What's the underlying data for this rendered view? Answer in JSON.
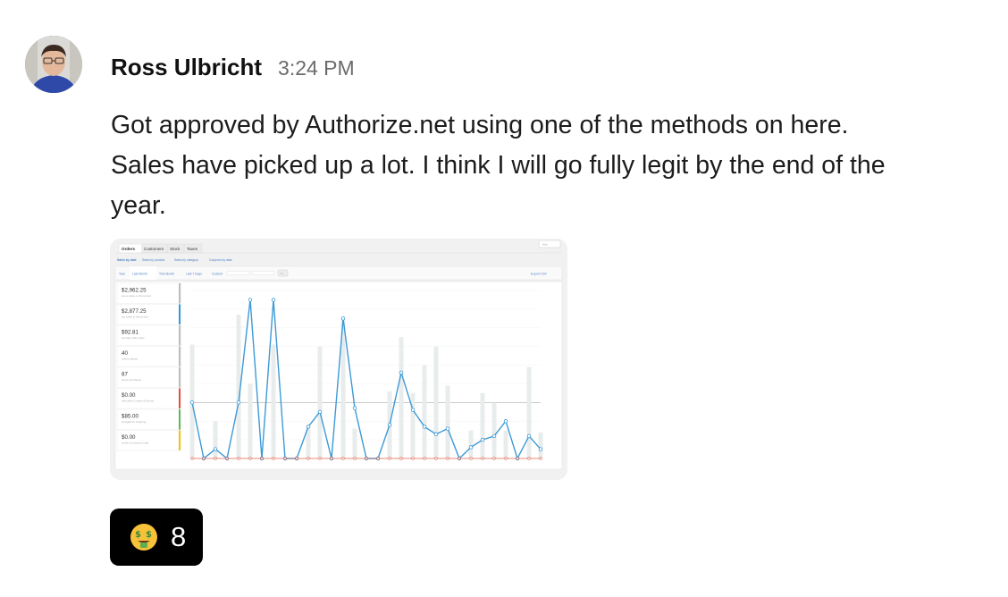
{
  "message": {
    "author": "Ross Ulbricht",
    "time": "3:24 PM",
    "lines": [
      "Got approved by Authorize.net using one of the methods on here.",
      "Sales have picked up a lot. I think I will go fully legit by the end of the",
      "year."
    ]
  },
  "reaction": {
    "emoji_icon": "money-mouth-face-icon",
    "count": "8"
  },
  "attachment": {
    "tabs": [
      "Orders",
      "Customers",
      "Stock",
      "Taxes"
    ],
    "help_label": "Help",
    "subnav": [
      "Sales by date",
      "Sales by product",
      "Sales by category",
      "Coupons by date"
    ],
    "ranges": [
      "Year",
      "Last Month",
      "This Month",
      "Last 7 Days",
      "Custom:"
    ],
    "go_label": "Go",
    "export_label": "Export CSV",
    "stats": [
      {
        "value": "$2,962.25",
        "label": "gross sales in this period"
      },
      {
        "value": "$2,877.25",
        "label": "net sales in this period"
      },
      {
        "value": "$92.81",
        "label": "average daily sales"
      },
      {
        "value": "40",
        "label": "orders placed"
      },
      {
        "value": "87",
        "label": "items purchased"
      },
      {
        "value": "$0.00",
        "label": "refunded 0 orders (0 items)"
      },
      {
        "value": "$85.00",
        "label": "charged for shipping"
      },
      {
        "value": "$0.00",
        "label": "worth of coupons used"
      }
    ],
    "stat_colors": [
      "#bbbbbb",
      "#3498db",
      "#bbbbbb",
      "#bbbbbb",
      "#bbbbbb",
      "#e74c3c",
      "#5cb85c",
      "#f1c40f"
    ]
  },
  "chart_data": {
    "type": "line",
    "x": [
      1,
      2,
      3,
      4,
      5,
      6,
      7,
      8,
      9,
      10,
      11,
      12,
      13,
      14,
      15,
      16,
      17,
      18,
      19,
      20,
      21,
      22,
      23,
      24,
      25,
      26,
      27,
      28,
      29,
      30,
      31
    ],
    "series": [
      {
        "values": [
          3,
          0,
          0.5,
          0,
          3,
          8.5,
          0,
          8.5,
          0,
          0,
          1.7,
          2.5,
          0,
          7.5,
          2.7,
          0,
          0,
          1.8,
          4.6,
          2.6,
          1.7,
          1.3,
          1.6,
          0,
          0.6,
          1,
          1.2,
          2,
          0,
          1.2,
          0.5
        ]
      },
      {
        "values": [
          0,
          0,
          0,
          0,
          0,
          0,
          0,
          0,
          0,
          0,
          0,
          0,
          0,
          0,
          0,
          0,
          0,
          0,
          0,
          0,
          0,
          0,
          0,
          0,
          0,
          0,
          0,
          0,
          0,
          0,
          0
        ]
      }
    ],
    "bars": [
      6.1,
      0,
      2,
      0,
      7.7,
      4,
      0,
      6.1,
      0,
      0,
      1.7,
      6,
      0,
      7.5,
      1.6,
      0,
      0,
      3.6,
      6.5,
      3.5,
      5,
      6,
      3.9,
      0,
      1.5,
      3.5,
      3,
      1.5,
      0,
      4.9,
      1.4
    ],
    "ylim": [
      0,
      9
    ]
  }
}
